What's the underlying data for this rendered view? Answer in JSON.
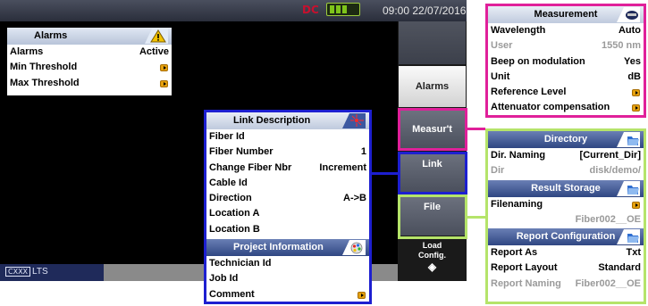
{
  "statusbar": {
    "ident": "DC",
    "datetime": "09:00 22/07/2016",
    "battery_level": 0.6
  },
  "softkeys": {
    "alarms": "Alarms",
    "measurt": "Measur't",
    "link": "Link",
    "file": "File",
    "load_line1": "Load",
    "load_line2": "Config."
  },
  "bottombar": {
    "tab_logo": "CXXX",
    "tab_label": "LTS"
  },
  "alarms_panel": {
    "title": "Alarms",
    "rows": [
      {
        "label": "Alarms",
        "value": "Active"
      },
      {
        "label": "Min Threshold",
        "value": ""
      },
      {
        "label": "Max Threshold",
        "value": ""
      }
    ]
  },
  "link_panel": {
    "title": "Link Description",
    "rows": [
      {
        "label": "Fiber Id",
        "value": ""
      },
      {
        "label": "Fiber Number",
        "value": "1"
      },
      {
        "label": "Change Fiber Nbr",
        "value": "Increment"
      },
      {
        "label": "Cable Id",
        "value": ""
      },
      {
        "label": "Direction",
        "value": "A->B"
      },
      {
        "label": "Location A",
        "value": ""
      },
      {
        "label": "Location B",
        "value": ""
      }
    ],
    "project_title": "Project Information",
    "project_rows": [
      {
        "label": "Technician Id",
        "value": ""
      },
      {
        "label": "Job Id",
        "value": ""
      },
      {
        "label": "Comment",
        "value": ""
      }
    ]
  },
  "meas_panel": {
    "title": "Measurement",
    "rows": [
      {
        "label": "Wavelength",
        "value": "Auto"
      },
      {
        "label": "User",
        "value": "1550 nm"
      },
      {
        "label": "Beep on modulation",
        "value": "Yes"
      },
      {
        "label": "Unit",
        "value": "dB"
      },
      {
        "label": "Reference Level",
        "value": ""
      },
      {
        "label": "Attenuator compensation",
        "value": ""
      }
    ]
  },
  "file_panel": {
    "dir_title": "Directory",
    "dir_rows": [
      {
        "label": "Dir. Naming",
        "value": "[Current_Dir]"
      },
      {
        "label": "Dir",
        "value": "disk/demo/"
      }
    ],
    "result_title": "Result Storage",
    "result_rows": [
      {
        "label": "Filenaming",
        "value": ""
      },
      {
        "label": "",
        "value": "Fiber002__OE"
      }
    ],
    "report_title": "Report Configuration",
    "report_rows": [
      {
        "label": "Report As",
        "value": "Txt"
      },
      {
        "label": "Report Layout",
        "value": "Standard"
      },
      {
        "label": "Report Naming",
        "value": "Fiber002__OE"
      }
    ]
  },
  "colors": {
    "measurement_highlight": "#e0209a",
    "link_highlight": "#1d1fd0",
    "file_highlight": "#b5e46a",
    "header_blue": "#2f4682",
    "arrow_button": "#e5a10e"
  },
  "icons": {
    "alarms": "warning-icon",
    "link": "laser-icon",
    "project": "palette-icon",
    "measurement": "instrument-badge-icon",
    "directory": "folder-icon",
    "load_config": "diamond-icon"
  }
}
